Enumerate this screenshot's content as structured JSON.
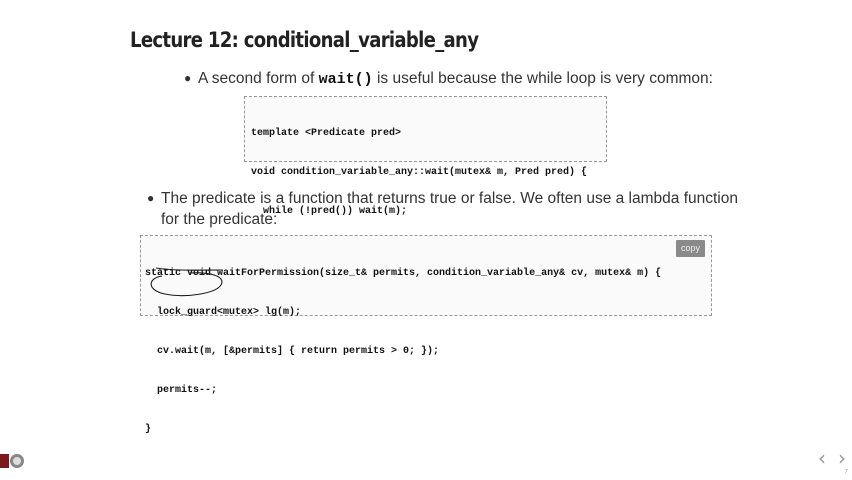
{
  "slide": {
    "title": "Lecture 12: conditional_variable_any"
  },
  "bullets": [
    {
      "pre": "A second form of ",
      "code": "wait()",
      "post": " is useful because the while loop is very common:"
    },
    {
      "line1": "The predicate is a function that returns true or false. We often use a lambda function",
      "line2": "for the predicate:"
    }
  ],
  "code_block_1": {
    "lines": [
      "template <Predicate pred>",
      "void condition_variable_any::wait(mutex& m, Pred pred) {",
      "  while (!pred()) wait(m);",
      "}"
    ]
  },
  "code_block_2": {
    "lines": [
      "static void waitForPermission(size_t& permits, condition_variable_any& cv, mutex& m) {",
      "  lock_guard<mutex> lg(m);",
      "  cv.wait(m, [&permits] { return permits > 0; });",
      "  permits--;",
      "}"
    ],
    "copy_label": "copy"
  },
  "nav": {
    "prev": "‹",
    "next": "›",
    "page": "7"
  },
  "colors": {
    "annotation_ink": "#1a1a1a",
    "copy_button_bg": "#8a8a8a"
  },
  "icons": {
    "logo": "seal-logo-icon",
    "prev": "chevron-left-icon",
    "next": "chevron-right-icon"
  }
}
